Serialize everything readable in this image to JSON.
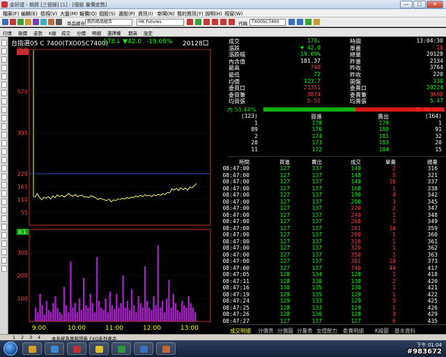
{
  "window": {
    "title": "金好證 - 期貨 [三個操] [1] - [個股 量價走勢]",
    "btn_min": "—",
    "btn_max": "□",
    "btn_close": "✕"
  },
  "menu": [
    "檔案(F)",
    "編輯(E)",
    "檢視(V)",
    "大盤(M)",
    "報價(Q)",
    "個股(S)",
    "選股(P)",
    "資訊(I)",
    "新聞(N)",
    "我的資訊(Y)",
    "說明(H)",
    "視窗(W)"
  ],
  "toolbar": {
    "group_label": "商品組合",
    "group_value": "我的商品組合",
    "market_value": "HK Futures",
    "symbol_label": "代碼",
    "symbol_value": "TXO05C7400"
  },
  "toolbar2": [
    "行情",
    "報價",
    "走勢",
    "K線",
    "成交",
    "分價",
    "明細",
    "選擇權",
    "期貨",
    "設定"
  ],
  "header": {
    "name": "台指選05 C 7400(TXO05C7400)",
    "price": "178",
    "arrow": "↓",
    "change": "▼42.0",
    "pct": "-19.09%",
    "volume": "20128口"
  },
  "chart_data": [
    {
      "type": "line",
      "x_ticks": [
        "9:00",
        "10:00",
        "11:00",
        "12:00",
        "13:00"
      ],
      "y_ticks": [
        750,
        570,
        395,
        220,
        165,
        110,
        55
      ],
      "ylim": [
        0,
        750
      ],
      "reference_line": 220,
      "color": "#ffff60",
      "series": [
        {
          "values": [
            118,
            135,
            120,
            108,
            120,
            115,
            122,
            112,
            125,
            118,
            130,
            122,
            128,
            120,
            126,
            135,
            128,
            124,
            130,
            122,
            126,
            128,
            120,
            122,
            118,
            126,
            122,
            118,
            110,
            115,
            112,
            108,
            105,
            112,
            100,
            108,
            105,
            112,
            110,
            115,
            112,
            118,
            115,
            120,
            118,
            125,
            120,
            128,
            122,
            130,
            125,
            128,
            122,
            130,
            126,
            132,
            128,
            135,
            130,
            140,
            138,
            155,
            150,
            158,
            148,
            160,
            152,
            158,
            150,
            162,
            160,
            168,
            178
          ]
        }
      ]
    },
    {
      "type": "bar",
      "y_ticks": [
        300,
        200,
        100
      ],
      "ylim": [
        0,
        400
      ],
      "color": "#a020c0",
      "series": [
        {
          "values": [
            60,
            40,
            120,
            70,
            30,
            90,
            50,
            40,
            80,
            110,
            60,
            40,
            30,
            150,
            70,
            40,
            260,
            60,
            80,
            40,
            100,
            50,
            190,
            70,
            60,
            120,
            80,
            40,
            280,
            90,
            60,
            50,
            100,
            40,
            130,
            70,
            55,
            120,
            60,
            80,
            200,
            60,
            90,
            50,
            140,
            70,
            40,
            110,
            80,
            60,
            240,
            90,
            60,
            50,
            110,
            70,
            330,
            60,
            90,
            40,
            100,
            180,
            60,
            120,
            80,
            50,
            40,
            90,
            70,
            60,
            110,
            80,
            60,
            40
          ]
        }
      ],
      "indicator_value": "0.1"
    }
  ],
  "quote": {
    "rows": [
      {
        "l1": "成交",
        "v1": "178↓",
        "c1": "#00ff00",
        "l2": "時間",
        "v2": "13:04:30",
        "c2": "#ffffff"
      },
      {
        "l1": "漲跌",
        "v1": "▼ 42.0",
        "c1": "#00ff00",
        "l2": "單量",
        "v2": "10",
        "c2": "#ff4040"
      },
      {
        "l1": "漲跌幅",
        "v1": "-19.09%",
        "c1": "#00ff00",
        "l2": "總量",
        "v2": "20128",
        "c2": "#ffffff"
      },
      {
        "l1": "內含值",
        "v1": "181.37",
        "c1": "#ffffff",
        "l2": "昨量",
        "v2": "2134",
        "c2": "#ffffff"
      },
      {
        "l1": "最高",
        "v1": "740",
        "c1": "#ff4040",
        "l2": "昨收",
        "v2": "3764",
        "c2": "#ffffff"
      },
      {
        "l1": "最低",
        "v1": "72",
        "c1": "#00ff00",
        "l2": "昨收",
        "v2": "220",
        "c2": "#ffffff"
      },
      {
        "l1": "均價",
        "v1": "123.7",
        "c1": "#00ff00",
        "l2": "開盤",
        "v2": "130",
        "c2": "#00ff00"
      },
      {
        "l1": "委買口",
        "v1": "21351",
        "c1": "#ff4040",
        "l2": "委賣口",
        "v2": "20224",
        "c2": "#00ff00"
      },
      {
        "l1": "委買筆",
        "v1": "3874",
        "c1": "#ff4040",
        "l2": "委賣筆",
        "v2": "3698",
        "c2": "#ff4040"
      },
      {
        "l1": "均買張",
        "v1": "5.51",
        "c1": "#ff4040",
        "l2": "均賣張",
        "v2": "5.47",
        "c2": "#00ff00"
      }
    ]
  },
  "ratio": {
    "inner": "內 51.44%",
    "outer": "外 48.56%"
  },
  "book": {
    "head": {
      "a": "(123)",
      "b": "買進",
      "c": "賣出",
      "d": "(164)"
    },
    "rows": [
      {
        "a": "1",
        "b": "178",
        "c": "179",
        "d": "1"
      },
      {
        "a": "89",
        "b": "176",
        "c": "180",
        "d": "91"
      },
      {
        "a": "2",
        "b": "174",
        "c": "181",
        "d": "32"
      },
      {
        "a": "20",
        "b": "173",
        "c": "183",
        "d": "20"
      },
      {
        "a": "11",
        "b": "172",
        "c": "184",
        "d": "15"
      }
    ]
  },
  "trades": {
    "columns": [
      "時間",
      "買進",
      "賣出",
      "成交",
      "單量",
      "總量"
    ],
    "rows": [
      [
        "08:47:00",
        "127",
        "137",
        "140",
        "2",
        "316"
      ],
      [
        "08:47:00",
        "127",
        "137",
        "148",
        "5",
        "321"
      ],
      [
        "08:47:00",
        "127",
        "137",
        "149",
        "16",
        "337"
      ],
      [
        "08:47:00",
        "127",
        "137",
        "168",
        "1",
        "338"
      ],
      [
        "08:47:00",
        "127",
        "137",
        "190",
        "4",
        "342"
      ],
      [
        "08:47:00",
        "127",
        "137",
        "200",
        "3",
        "345"
      ],
      [
        "08:47:00",
        "127",
        "137",
        "220",
        "2",
        "347"
      ],
      [
        "08:47:00",
        "127",
        "137",
        "240",
        "1",
        "348"
      ],
      [
        "08:47:00",
        "127",
        "137",
        "268",
        "1",
        "349"
      ],
      [
        "08:47:00",
        "127",
        "137",
        "281",
        "10",
        "359"
      ],
      [
        "08:47:00",
        "127",
        "137",
        "288",
        "1",
        "360"
      ],
      [
        "08:47:00",
        "127",
        "137",
        "316",
        "1",
        "361"
      ],
      [
        "08:47:00",
        "127",
        "137",
        "320",
        "1",
        "362"
      ],
      [
        "08:47:00",
        "127",
        "137",
        "350",
        "1",
        "363"
      ],
      [
        "08:47:00",
        "127",
        "137",
        "381",
        "10",
        "373"
      ],
      [
        "08:47:00",
        "127",
        "137",
        "740",
        "44",
        "417"
      ],
      [
        "08:47:05",
        "128",
        "134",
        "128",
        "1",
        "418"
      ],
      [
        "08:47:11",
        "128",
        "130",
        "130",
        "2",
        "420"
      ],
      [
        "08:47:16",
        "130",
        "135",
        "130",
        "1",
        "421"
      ],
      [
        "08:47:19",
        "129",
        "135",
        "129",
        "1",
        "422"
      ],
      [
        "08:47:24",
        "129",
        "133",
        "129",
        "3",
        "425"
      ],
      [
        "08:47:25",
        "128",
        "133",
        "129",
        "1",
        "426"
      ],
      [
        "08:47:26",
        "128",
        "136",
        "128",
        "3",
        "429"
      ],
      [
        "08:47:27",
        "127",
        "137",
        "127",
        "6",
        "435"
      ]
    ]
  },
  "tabs": [
    "成交明細",
    "分價表",
    "分價圖",
    "分量表",
    "支撐壓力",
    "委賣明細",
    "K線圖",
    "基本資料"
  ],
  "status": {
    "pages": [
      "1",
      "2",
      "3",
      "4"
    ],
    "text": "本系統為富邦證券 FXQ系列產品",
    "clock_time": "下午 01:04",
    "clock_date": "2008/5/7"
  },
  "watermark": "#983672",
  "colors": {
    "accent": "#ffff00",
    "up": "#ff4040",
    "down": "#00ff00",
    "volume": "#a020c0"
  }
}
